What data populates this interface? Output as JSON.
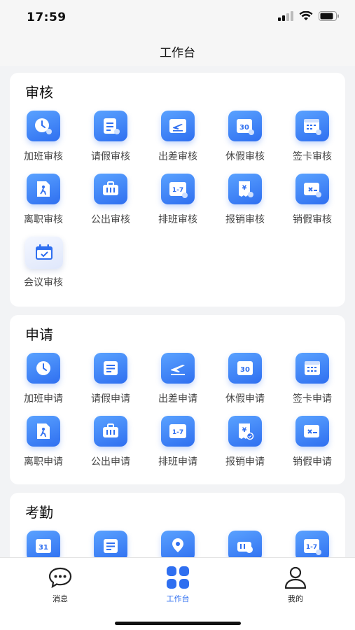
{
  "status_bar": {
    "time": "17:59"
  },
  "nav": {
    "title": "工作台"
  },
  "sections": [
    {
      "title": "审核",
      "items": [
        {
          "label": "加班审核",
          "icon": "clock-user-icon"
        },
        {
          "label": "请假审核",
          "icon": "form-user-icon"
        },
        {
          "label": "出差审核",
          "icon": "plane-icon"
        },
        {
          "label": "休假审核",
          "icon": "calendar-30-icon"
        },
        {
          "label": "签卡审核",
          "icon": "calendar-grid-icon"
        },
        {
          "label": "离职审核",
          "icon": "doc-walk-icon"
        },
        {
          "label": "公出审核",
          "icon": "briefcase-icon"
        },
        {
          "label": "排班审核",
          "icon": "calendar-1-7-icon"
        },
        {
          "label": "报销审核",
          "icon": "receipt-yen-icon"
        },
        {
          "label": "销假审核",
          "icon": "calendar-cancel-icon"
        },
        {
          "label": "会议审核",
          "icon": "calendar-check-icon"
        }
      ]
    },
    {
      "title": "申请",
      "items": [
        {
          "label": "加班申请",
          "icon": "clock-icon"
        },
        {
          "label": "请假申请",
          "icon": "form-icon"
        },
        {
          "label": "出差申请",
          "icon": "plane-icon"
        },
        {
          "label": "休假申请",
          "icon": "calendar-30-icon"
        },
        {
          "label": "签卡申请",
          "icon": "calendar-grid-icon"
        },
        {
          "label": "离职申请",
          "icon": "doc-walk-icon"
        },
        {
          "label": "公出申请",
          "icon": "briefcase-icon"
        },
        {
          "label": "排班申请",
          "icon": "calendar-1-7-icon"
        },
        {
          "label": "报销申请",
          "icon": "receipt-yen-icon"
        },
        {
          "label": "销假申请",
          "icon": "calendar-cancel-icon"
        }
      ]
    },
    {
      "title": "考勤",
      "items": [
        {
          "label": "",
          "icon": "calendar-31-icon"
        },
        {
          "label": "",
          "icon": "form-icon"
        },
        {
          "label": "",
          "icon": "location-pin-icon"
        },
        {
          "label": "",
          "icon": "briefcase-search-icon"
        },
        {
          "label": "",
          "icon": "calendar-1-7-user-icon"
        }
      ]
    }
  ],
  "tabs": [
    {
      "label": "消息",
      "icon": "chat-bubble-icon",
      "active": false
    },
    {
      "label": "工作台",
      "icon": "grid-apps-icon",
      "active": true
    },
    {
      "label": "我的",
      "icon": "person-icon",
      "active": false
    }
  ],
  "colors": {
    "accent": "#2f6ff0",
    "accent_light": "#5aa2ff",
    "card_bg": "#ffffff",
    "page_bg": "#f2f3f5"
  }
}
